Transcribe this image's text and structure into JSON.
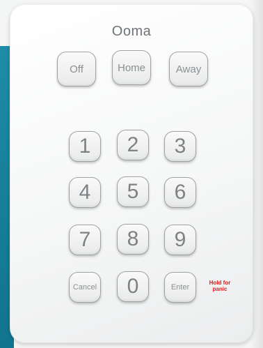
{
  "keypad": {
    "brand": "Ooma",
    "mode_buttons": [
      "Off",
      "Home",
      "Away"
    ],
    "digits": [
      "1",
      "2",
      "3",
      "4",
      "5",
      "6",
      "7",
      "8",
      "9",
      "0"
    ],
    "cancel_label": "Cancel",
    "enter_label": "Enter",
    "panic_note": {
      "line1": "Hold for",
      "line2": "panic"
    },
    "colors": {
      "panic_text": "#e01a1a",
      "background_wall": "#157d98",
      "body": "#f6f7f7"
    }
  }
}
